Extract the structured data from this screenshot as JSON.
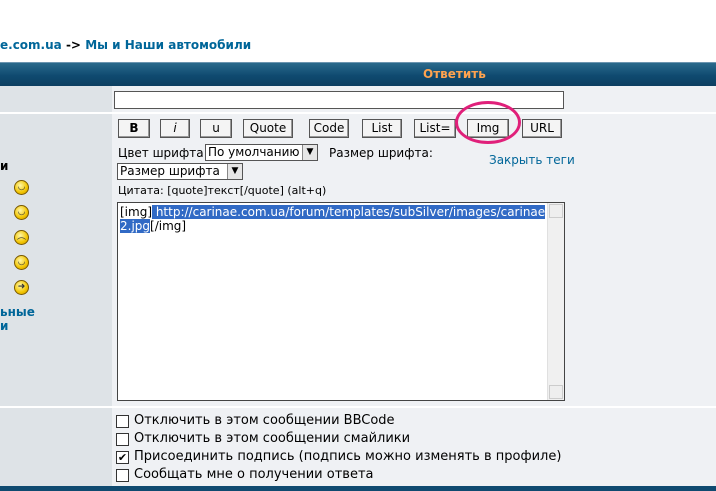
{
  "breadcrumb": {
    "site": "e.com.ua",
    "separator": "->",
    "section": "Мы и Наши автомобили"
  },
  "header": {
    "title": "Ответить"
  },
  "subject": {
    "value": ""
  },
  "toolbar": {
    "bold": "B",
    "italic": "i",
    "underline": "u",
    "quote": "Quote",
    "code": "Code",
    "list": "List",
    "list_ordered": "List=",
    "img": "Img",
    "url": "URL"
  },
  "font": {
    "color_label": "Цвет шрифта:",
    "color_value": "По умолчанию",
    "size_label": "Размер шрифта:",
    "size_value": "Размер шрифта",
    "close_tags": "Закрыть теги"
  },
  "hint": "Цитата: [quote]текст[/quote]  (alt+q)",
  "message": {
    "prefix": "[img]",
    "selected": " http://carinae.com.ua/forum/templates/subSilver/images/carinae2.jpg",
    "suffix": "[/img]"
  },
  "left": {
    "fragment": "и",
    "link_line1": "ьные",
    "link_line2": "и"
  },
  "options": [
    {
      "label": "Отключить в этом сообщении BBCode",
      "checked": false
    },
    {
      "label": "Отключить в этом сообщении смайлики",
      "checked": false
    },
    {
      "label": "Присоединить подпись (подпись можно изменять в профиле)",
      "checked": true
    },
    {
      "label": "Сообщать мне о получении ответа",
      "checked": false
    }
  ],
  "icons": {
    "emoticons": [
      "laughing-emoticon-icon",
      "grin-emoticon-icon",
      "sad-emoticon-icon",
      "wink-emoticon-icon",
      "arrow-emoticon-icon"
    ],
    "check_mark": "✔"
  },
  "colors": {
    "link": "#006699",
    "header_text": "#ffa34f",
    "header_bg": "#0f4a70",
    "selection": "#316ac5",
    "annotation": "#e0207a"
  }
}
